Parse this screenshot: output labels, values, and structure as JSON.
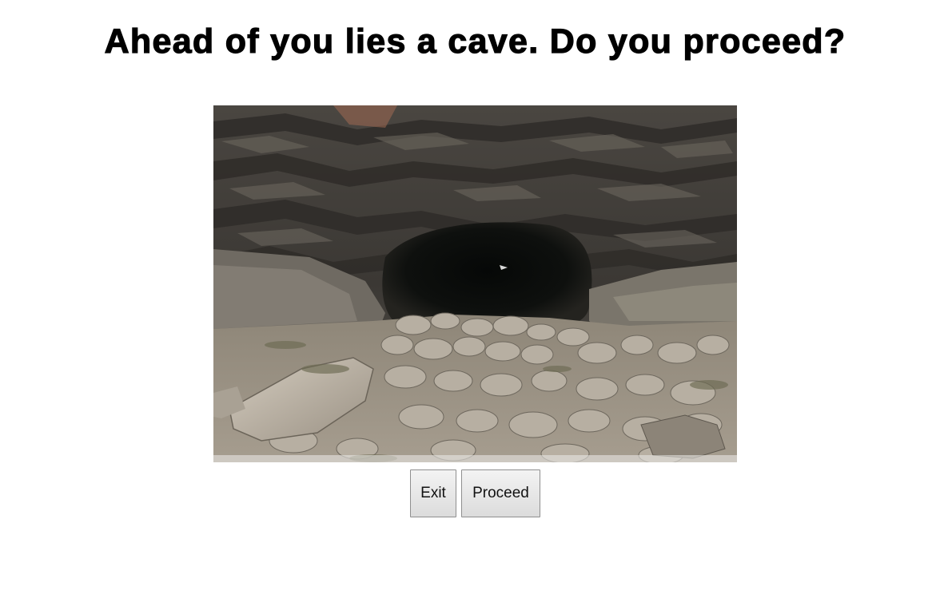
{
  "scene": {
    "prompt": "Ahead of you lies a cave. Do you proceed?",
    "image": "cave-entrance-photo",
    "colors": {
      "rock_dark": "#3a3733",
      "rock_mid": "#5d5952",
      "rubble_light": "#b6ada0",
      "cave_mouth": "#0d0f0d",
      "moss": "#6c6a52"
    }
  },
  "choices": {
    "exit_label": "Exit",
    "proceed_label": "Proceed"
  }
}
